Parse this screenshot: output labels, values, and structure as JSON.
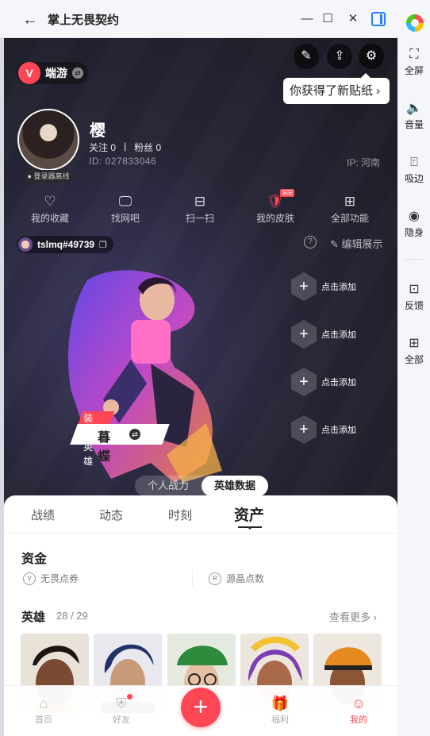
{
  "window": {
    "title": "掌上无畏契约"
  },
  "sidepanel": {
    "items": [
      {
        "label": "全屏",
        "icon": "fullscreen-icon"
      },
      {
        "label": "音量",
        "icon": "volume-icon"
      },
      {
        "label": "吸边",
        "icon": "dock-edge-icon"
      },
      {
        "label": "隐身",
        "icon": "eye-icon"
      },
      {
        "label": "反馈",
        "icon": "feedback-icon"
      },
      {
        "label": "全部",
        "icon": "grid-icon"
      }
    ]
  },
  "header": {
    "brand": "端游",
    "tooltip": "你获得了新贴纸 ›"
  },
  "profile": {
    "nickname": "樱",
    "login_badge": "● 登录器离线",
    "follow": "关注 0",
    "divider": "|",
    "fans": "粉丝 0",
    "uid": "ID: 027833046",
    "ip": "IP: 河南"
  },
  "quick_actions": [
    {
      "label": "我的收藏",
      "icon": "heart-icon",
      "glyph": "♡"
    },
    {
      "label": "找网吧",
      "icon": "monitor-icon",
      "glyph": "🖵"
    },
    {
      "label": "扫一扫",
      "icon": "scan-icon",
      "glyph": "⊟"
    },
    {
      "label": "我的皮肤",
      "icon": "skin-icon",
      "glyph": "🛡",
      "tag": "装配"
    },
    {
      "label": "全部功能",
      "icon": "grid-icon",
      "glyph": "⊞"
    }
  ],
  "riot": {
    "id": "tslmq#49739",
    "edit": "编辑展示"
  },
  "agent": {
    "equip_label": "装配英雄",
    "name": "暮蝶"
  },
  "add_slots": [
    "点击添加",
    "点击添加",
    "点击添加",
    "点击添加"
  ],
  "segment": {
    "left": "个人战力",
    "right": "英雄数据"
  },
  "tabs": [
    "战绩",
    "动态",
    "时刻",
    "资产"
  ],
  "assets": {
    "title": "资金",
    "items": [
      {
        "label": "无畏点券",
        "icon": "v-coin-icon",
        "glyph": "V"
      },
      {
        "label": "源晶点数",
        "icon": "r-coin-icon",
        "glyph": "R"
      }
    ]
  },
  "heroes": {
    "title": "英雄",
    "count": "28 / 29",
    "see_more": "查看更多 ›"
  },
  "bottom_nav": [
    {
      "label": "首页",
      "icon": "home-icon",
      "glyph": "⌂"
    },
    {
      "label": "好友",
      "icon": "friends-icon",
      "glyph": "⛨"
    },
    {
      "label": "福利",
      "icon": "gift-icon",
      "glyph": "🎁"
    },
    {
      "label": "我的",
      "icon": "profile-icon",
      "glyph": "☺"
    }
  ],
  "colors": {
    "accent": "#ff4655",
    "hero_bg": "#1d1d29"
  }
}
